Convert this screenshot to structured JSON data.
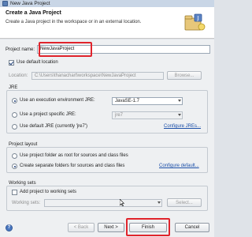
{
  "window": {
    "title": "New Java Project"
  },
  "header": {
    "title": "Create a Java Project",
    "description": "Create a Java project in the workspace or in an external location."
  },
  "project": {
    "name_label": "Project name:",
    "name_value": "NewJavaProject",
    "use_default_location_label": "Use default location",
    "use_default_location_checked": true,
    "location_label": "Location:",
    "location_value": "C:\\Users\\thanachart\\workspace\\NewJavaProject",
    "browse_label": "Browse..."
  },
  "jre": {
    "group_label": "JRE",
    "option_env_label": "Use an execution environment JRE:",
    "option_env_value": "JavaSE-1.7",
    "option_specific_label": "Use a project specific JRE:",
    "option_specific_value": "jre7",
    "option_default_label": "Use default JRE (currently 'jre7')",
    "configure_link": "Configure JREs..."
  },
  "layout": {
    "group_label": "Project layout",
    "option_root_label": "Use project folder as root for sources and class files",
    "option_separate_label": "Create separate folders for sources and class files",
    "configure_link": "Configure default..."
  },
  "working_sets": {
    "group_label": "Working sets",
    "add_label": "Add project to working sets",
    "add_checked": false,
    "sets_label": "Working sets:",
    "select_label": "Select..."
  },
  "footer": {
    "help_symbol": "?",
    "back_label": "< Back",
    "next_label": "Next >",
    "finish_label": "Finish",
    "cancel_label": "Cancel"
  },
  "colors": {
    "highlight_outline": "#e0242c",
    "link": "#1b4fa8"
  }
}
